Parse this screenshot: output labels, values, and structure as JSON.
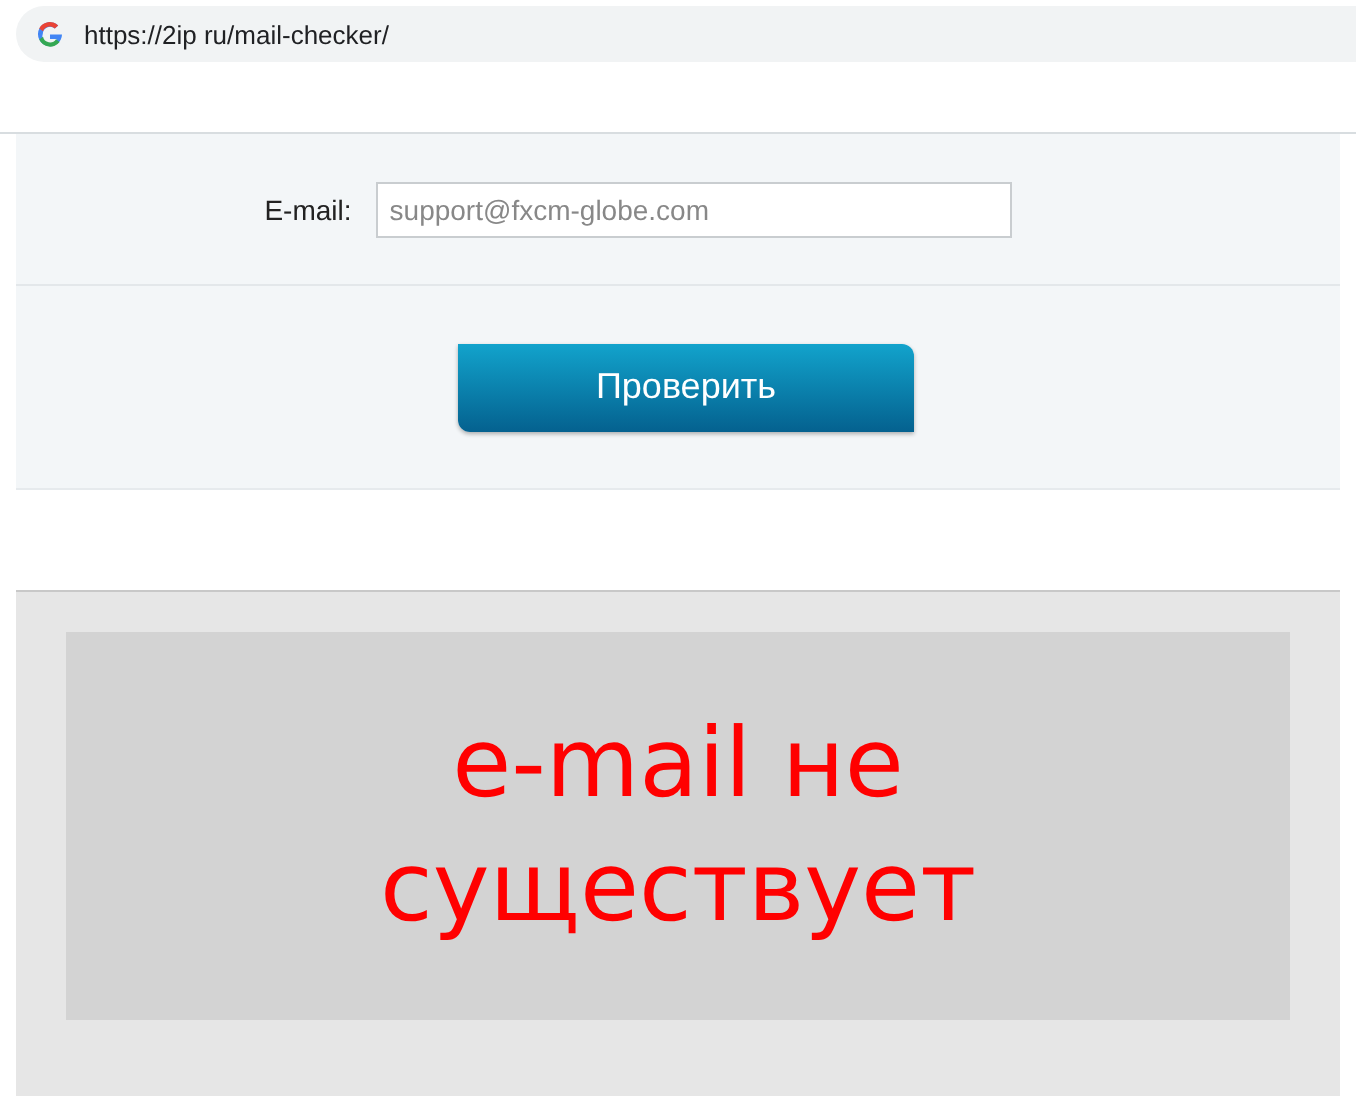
{
  "browser": {
    "url": "https://2ip ru/mail-checker/"
  },
  "form": {
    "email_label": "E-mail:",
    "email_value": "support@fxcm-globe.com",
    "button": "Проверить"
  },
  "result": {
    "message": "e-mail не существует"
  }
}
